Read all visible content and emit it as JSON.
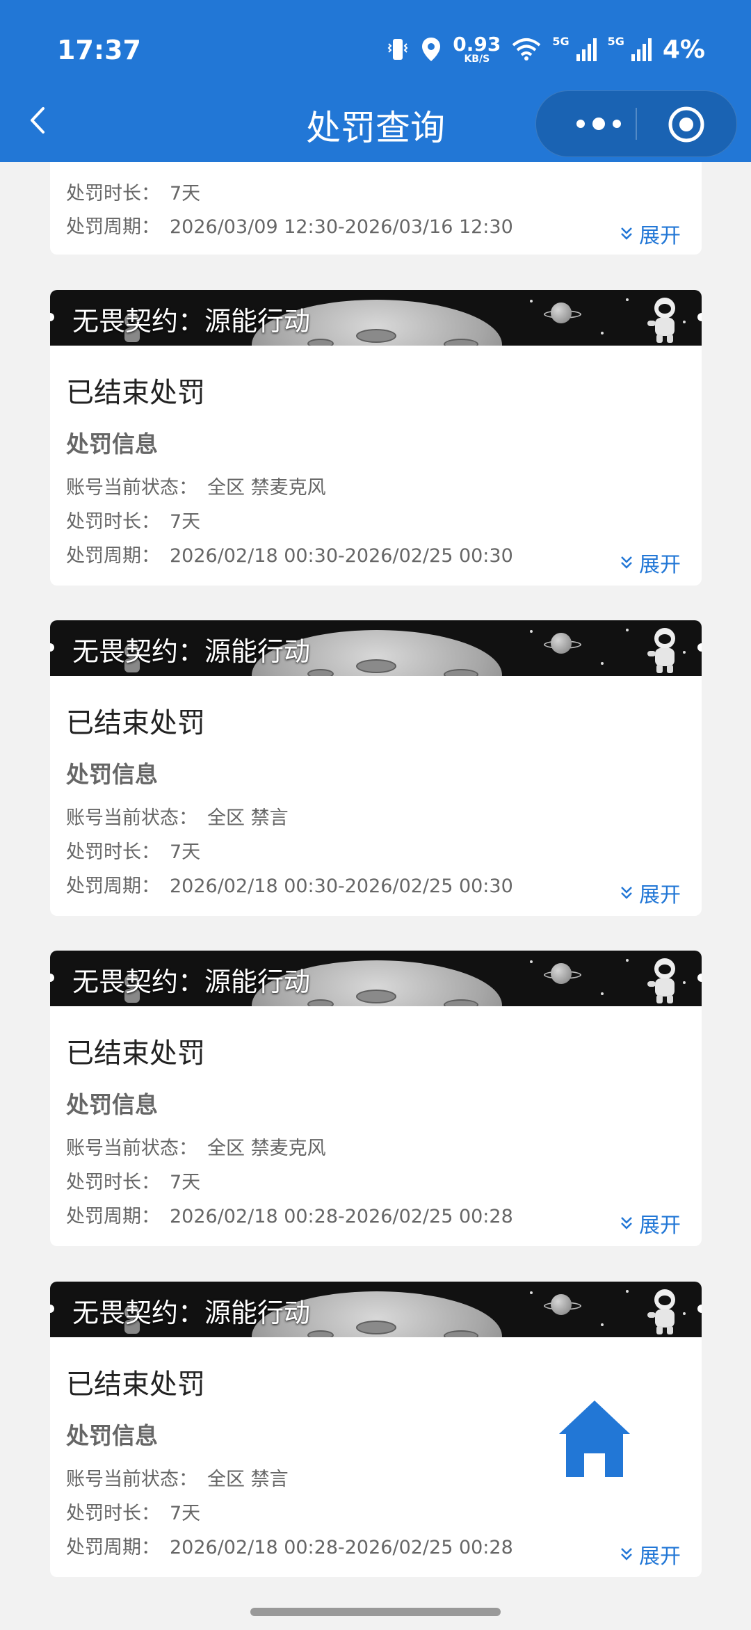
{
  "status_bar": {
    "time": "17:37",
    "speed_value": "0.93",
    "speed_unit": "KB/S",
    "network_1": "5G",
    "network_2": "5G",
    "battery": "4%"
  },
  "header": {
    "title": "处罚查询",
    "back_icon": "chevron-left-icon",
    "more_icon": "more-dots-icon",
    "close_icon": "target-circle-icon"
  },
  "colors": {
    "primary": "#2277d6",
    "background": "#f2f2f2",
    "card": "#ffffff"
  },
  "partial_card": {
    "duration_label": "处罚时长：",
    "duration_value": "7天",
    "period_label": "处罚周期：",
    "period_value": "2026/03/09 12:30-2026/03/16 12:30",
    "expand_label": "展开"
  },
  "cards": [
    {
      "game": "无畏契约：源能行动",
      "status": "已结束处罚",
      "section": "处罚信息",
      "account_label": "账号当前状态：",
      "account_value": "全区 禁麦克风",
      "duration_label": "处罚时长：",
      "duration_value": "7天",
      "period_label": "处罚周期：",
      "period_value": "2026/02/18 00:30-2026/02/25 00:30",
      "expand_label": "展开"
    },
    {
      "game": "无畏契约：源能行动",
      "status": "已结束处罚",
      "section": "处罚信息",
      "account_label": "账号当前状态：",
      "account_value": "全区 禁言",
      "duration_label": "处罚时长：",
      "duration_value": "7天",
      "period_label": "处罚周期：",
      "period_value": "2026/02/18 00:30-2026/02/25 00:30",
      "expand_label": "展开"
    },
    {
      "game": "无畏契约：源能行动",
      "status": "已结束处罚",
      "section": "处罚信息",
      "account_label": "账号当前状态：",
      "account_value": "全区 禁麦克风",
      "duration_label": "处罚时长：",
      "duration_value": "7天",
      "period_label": "处罚周期：",
      "period_value": "2026/02/18 00:28-2026/02/25 00:28",
      "expand_label": "展开"
    },
    {
      "game": "无畏契约：源能行动",
      "status": "已结束处罚",
      "section": "处罚信息",
      "account_label": "账号当前状态：",
      "account_value": "全区 禁言",
      "duration_label": "处罚时长：",
      "duration_value": "7天",
      "period_label": "处罚周期：",
      "period_value": "2026/02/18 00:28-2026/02/25 00:28",
      "expand_label": "展开"
    }
  ],
  "fab": {
    "icon": "home-icon"
  }
}
